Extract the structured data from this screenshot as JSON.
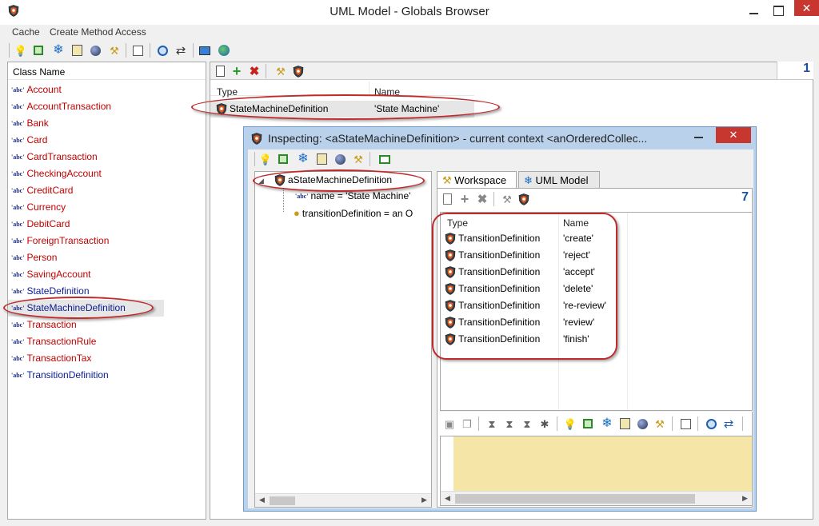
{
  "window": {
    "title": "UML Model - Globals Browser",
    "close": "✕"
  },
  "menu": [
    "Cache",
    "Create Method Access"
  ],
  "left_panel": {
    "header": "Class Name",
    "abc": "'abc'",
    "classes": [
      {
        "name": "Account",
        "color": "red"
      },
      {
        "name": "AccountTransaction",
        "color": "red"
      },
      {
        "name": "Bank",
        "color": "red"
      },
      {
        "name": "Card",
        "color": "red"
      },
      {
        "name": "CardTransaction",
        "color": "red"
      },
      {
        "name": "CheckingAccount",
        "color": "red"
      },
      {
        "name": "CreditCard",
        "color": "red"
      },
      {
        "name": "Currency",
        "color": "red"
      },
      {
        "name": "DebitCard",
        "color": "red"
      },
      {
        "name": "ForeignTransaction",
        "color": "red"
      },
      {
        "name": "Person",
        "color": "red"
      },
      {
        "name": "SavingAccount",
        "color": "red"
      },
      {
        "name": "StateDefinition",
        "color": "blue"
      },
      {
        "name": "StateMachineDefinition",
        "color": "blue",
        "selected": true
      },
      {
        "name": "Transaction",
        "color": "red"
      },
      {
        "name": "TransactionRule",
        "color": "red"
      },
      {
        "name": "TransactionTax",
        "color": "red"
      },
      {
        "name": "TransitionDefinition",
        "color": "blue"
      }
    ]
  },
  "right_panel": {
    "count": "1",
    "columns": [
      "Type",
      "Name"
    ],
    "rows": [
      {
        "type": "StateMachineDefinition",
        "name": "'State Machine'"
      }
    ]
  },
  "inspector": {
    "title": "Inspecting: <aStateMachineDefinition> - current context <anOrderedCollec...",
    "close": "✕",
    "tree": {
      "root": "aStateMachineDefinition",
      "children": [
        "name = 'State Machine'",
        "transitionDefinition = an O"
      ]
    },
    "tabs": [
      "Workspace",
      "UML Model"
    ],
    "count": "7",
    "columns": [
      "Type",
      "Name"
    ],
    "rows": [
      {
        "type": "TransitionDefinition",
        "name": "'create'"
      },
      {
        "type": "TransitionDefinition",
        "name": "'reject'"
      },
      {
        "type": "TransitionDefinition",
        "name": "'accept'"
      },
      {
        "type": "TransitionDefinition",
        "name": "'delete'"
      },
      {
        "type": "TransitionDefinition",
        "name": "'re-review'"
      },
      {
        "type": "TransitionDefinition",
        "name": "'review'"
      },
      {
        "type": "TransitionDefinition",
        "name": "'finish'"
      }
    ]
  },
  "colors": {
    "highlight": "#c02a2a",
    "class_red": "#c00000",
    "class_blue": "#0b1c92",
    "workspace_bg": "#f5e6a8"
  }
}
